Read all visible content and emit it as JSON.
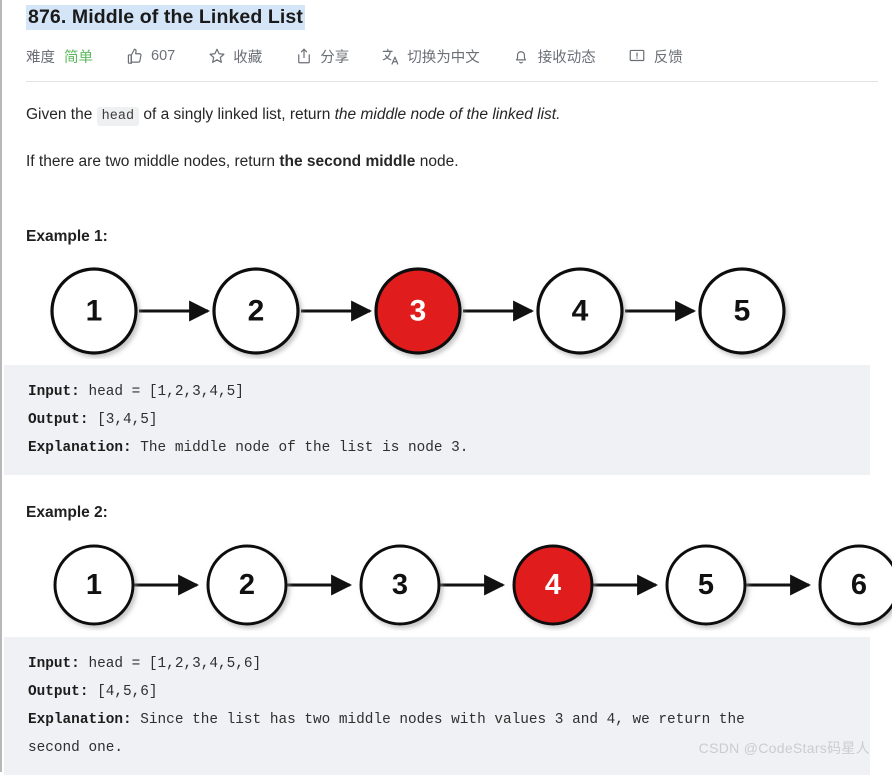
{
  "header": {
    "title": "876. Middle of the Linked List",
    "meta": [
      {
        "name": "difficulty",
        "icon": null,
        "label": "难度",
        "value": "简单"
      },
      {
        "name": "likes",
        "icon": "thumbs-up-icon",
        "label": "607",
        "value": null
      },
      {
        "name": "favorite",
        "icon": "star-icon",
        "label": "收藏",
        "value": null
      },
      {
        "name": "share",
        "icon": "share-icon",
        "label": "分享",
        "value": null
      },
      {
        "name": "translate",
        "icon": "translate-icon",
        "label": "切换为中文",
        "value": null
      },
      {
        "name": "subscribe",
        "icon": "bell-icon",
        "label": "接收动态",
        "value": null
      },
      {
        "name": "feedback",
        "icon": "feedback-icon",
        "label": "反馈",
        "value": null
      }
    ]
  },
  "description": {
    "p1_a": "Given the ",
    "p1_code": "head",
    "p1_b": " of a singly linked list, return ",
    "p1_italic": "the middle node of the linked list.",
    "p2_a": "If there are two middle nodes, return ",
    "p2_bold": "the second middle",
    "p2_b": " node."
  },
  "examples": [
    {
      "heading": "Example 1:",
      "diagram": {
        "nodes": [
          {
            "value": "1",
            "highlight": false
          },
          {
            "value": "2",
            "highlight": false
          },
          {
            "value": "3",
            "highlight": true
          },
          {
            "value": "4",
            "highlight": false
          },
          {
            "value": "5",
            "highlight": false
          }
        ],
        "highlight_color": "#e01b1b",
        "node_fill": "#ffffff",
        "stroke_color": "#111111"
      },
      "code": [
        {
          "key": "Input:",
          "rest": " head = [1,2,3,4,5]"
        },
        {
          "key": "Output:",
          "rest": " [3,4,5]"
        },
        {
          "key": "Explanation:",
          "rest": " The middle node of the list is node 3."
        }
      ]
    },
    {
      "heading": "Example 2:",
      "diagram": {
        "nodes": [
          {
            "value": "1",
            "highlight": false
          },
          {
            "value": "2",
            "highlight": false
          },
          {
            "value": "3",
            "highlight": false
          },
          {
            "value": "4",
            "highlight": true
          },
          {
            "value": "5",
            "highlight": false
          },
          {
            "value": "6",
            "highlight": false
          }
        ],
        "highlight_color": "#e01b1b",
        "node_fill": "#ffffff",
        "stroke_color": "#111111"
      },
      "code": [
        {
          "key": "Input:",
          "rest": " head = [1,2,3,4,5,6]"
        },
        {
          "key": "Output:",
          "rest": " [4,5,6]"
        },
        {
          "key": "Explanation:",
          "rest": " Since the list has two middle nodes with values 3 and 4, we return the"
        },
        {
          "key": "",
          "rest": "second one."
        }
      ]
    }
  ],
  "watermark": "CSDN @CodeStars码星人"
}
